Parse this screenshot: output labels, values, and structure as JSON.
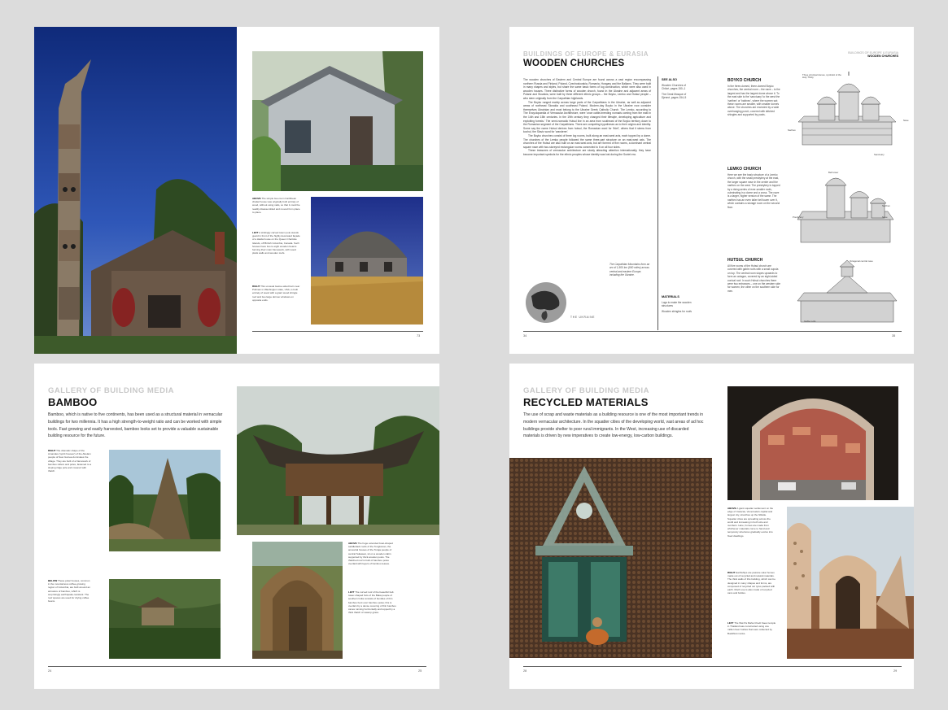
{
  "spread1": {
    "captions": [
      {
        "label": "ABOVE",
        "text": "The simple two-room Caribbean chattel house was originally built entirely of wood, without using nails, so that it could be readily disassembled and moved from place to place."
      },
      {
        "label": "LEFT",
        "text": "A strikingly carved totem pole stands guard in front of the highly decorated façade of a Haida house on the Queen Charlotte Islands, off British Columbia, Canada. Such houses have two to eight wooden beams forming their main framework, with wood plank walls and wooden roofs."
      },
      {
        "label": "RIGHT",
        "text": "This unusual twelve-sided barn near Pullman in Washington state, USA, is built entirely of wood with a giant wood shingle roof and two large dormer windows on opposite ends."
      }
    ],
    "page_right": "73"
  },
  "spread2": {
    "kicker": "BUILDINGS OF EUROPE & EURASIA",
    "title": "WOODEN CHURCHES",
    "running_head_1": "BUILDINGS OF EUROPE & EURASIA",
    "running_head_2": "WOODEN CHURCHES",
    "body": [
      "The wooden churches of Eastern and Central Europe are found across a vast region encompassing northern Russia and Finland, Poland, Czechoslovakia, Romania, Hungary and the Balkans. They were built in many shapes and styles, but share the same basic forms of log construction, which were also used in wooden houses. Three distinctive forms of wooden church, found in the Ukraine and adjacent areas of Poland and Slovakia, were built by three different ethnic groups – the Boyko, Lemko and Hutsul people – who stem originally from the Carpathian highlands.",
      "The Boyko ranged mainly across large parts of the Carpathians in the Ukraine, as well as adjacent areas of northeast Slovakia and southeast Poland. Modern-day Boyko in the Ukraine now consider themselves Ukrainian and most belong to the Ukraine Greek Catholic Church. The Lemko, according to The Encyclopaedia of Vernacular Architecture, were 'once cattle-breeding nomads coming from the east in the 14th and 15th centuries. In the 19th century they changed their lifestyle, developing agriculture and exploiting forests.' The semi-nomadic Hutsul live in an area from southeast of the Boyko territory down to the Romanian segment of the Carpathians. There are competing hypotheses as to their origins and identity. Some say the name Hutsul derives from hotsul, the Romanian word for 'thief', others that it stems from kochul, the Slavic word for 'wanderer'.",
      "The Boyko churches consist of three log rooms, built along an east-west axis, each topped by a dome. The churches of the Lemko people followed the same three-part structure on an east-west axis. The churches of the Hutsul are also built on an east-west axis, but are formed of five rooms, a dominant central square nave with two-storeyed rectangular rooms connected to it on all four sides.",
      "These treasures of vernacular architecture are slowly attracting attention internationally, they have become important symbols for the ethnic peoples whose identity was lost during the Soviet era."
    ],
    "see_also_label": "SEE ALSO",
    "see_also_items": [
      "Wooden Churches of Chiloé, pages 150–1",
      "The Great Mosque of Djenné, pages 154–5"
    ],
    "materials_label": "MATERIALS",
    "materials_items": [
      "Logs to make the wooden structures",
      "Wooden shingles for roofs"
    ],
    "map_caption": "The Carpathian Mountains form an arc of 1,500 km (900 miles) across central and eastern Europe, including the Ukraine.",
    "map_label": "THE UKRAINE",
    "sections": [
      {
        "heading": "BOYKO CHURCH",
        "text": "In the three-domed, three-domed Boyko churches, the central room – the nave – is the largest and has the largest dome above it. To the east side is the 'sanctuary' to the west the 'narthex' or 'babinec', where the women sat; these rooms are smaller, with smaller domes above. The churches are encircled by a wide overhanging porch, covered with stitched shingles and supported by posts."
      },
      {
        "heading": "LEMKO CHURCH",
        "text": "Here we see the basic structure of a Lemko church, with the small presbytery at the east, the larger square nave in the centre and the narthex on the west. The presbytery is topped by a rising series of ever-smaller roofs, culminating in a dome and a cross. The nave is a larger, higher version of the same. The narthex has an even taller bell tower over it, which contains a storage room on the second floor."
      },
      {
        "heading": "HUTSUL CHURCH",
        "text": "All five rooms of the Hutsul church are covered with gable roofs with a small cupola on top. The central room slopes upwards to form an octagon, covered by an eight-sided conical roof. In such Hutsul churches there were two entrances – one on the western side for women, the other on the southern side for men."
      }
    ],
    "diagram_labels": {
      "boyko_top": "Three principal domes, symbolic of the Holy Trinity",
      "boyko_narthex": "Narthex",
      "boyko_nave": "Nave",
      "boyko_sanctuary": "Sanctuary",
      "lemko_bell": "Bell tower",
      "lemko_narthex": "Narthex",
      "lemko_presbytery": "Presbytery",
      "lemko_nave": "Nave",
      "hutsul_octagon": "Octagonal central nave",
      "hutsul_gable": "Gable roofs"
    },
    "page_left": "34",
    "page_right": "35"
  },
  "spread3": {
    "kicker": "GALLERY OF BUILDING MEDIA",
    "title": "BAMBOO",
    "intro": "Bamboo, which is native to five continents, has been used as a structural material in vernacular buildings for two millennia. It has a high strength-to-weight ratio and can be worked with simple tools. Fast growing and easily harvested, bamboo looks set to provide a valuable sustainable building resource for the future.",
    "captions": [
      {
        "label": "RIGHT",
        "text": "The dramatic shape of the Amandes ('spirit houses') of the Abelam people of New Guinea dominates the village. They are built of a framework of bamboo rafters and poles, fastened to a sloping ridge pole and covered with thatch."
      },
      {
        "label": "BELOW",
        "text": "These polar houses, common in the mountainous coffee-growing region of Colombia, are built around an armature of bamboo, which is surprisingly earthquake-resistant. The roof spaces are used for drying coffee beans."
      },
      {
        "label": "ABOVE",
        "text": "The huge extended boat-shaped saddleback roofs of the Tongkonan, the ancestral houses of the Toraja people of central Sulawesi, sit on a wooden cabin supported by thick wooden posts. The thatched roof is built of bamboo poles overlaid with layers of bamboo leaves."
      },
      {
        "label": "LEFT",
        "text": "The curved roof of the beautiful bell-tower-shaped huts of the Baka people of southern India consists of bundles of thin bamboo bent over bamboo poles; this is overlain by a dense covering of thin bamboo canes running horizontally and topped by a thick thatch of swamp grass."
      }
    ],
    "page_left": "24",
    "page_right": "25"
  },
  "spread4": {
    "kicker": "GALLERY OF BUILDING MEDIA",
    "title": "RECYCLED MATERIALS",
    "intro": "The use of scrap and waste materials as a building resource is one of the most important trends in modern vernacular architecture. In the squatter cities of the developing world, vast areas of ad hoc buildings provide shelter to poor rural immigrants. In the West, increasing use of discarded materials is driven by new imperatives to create low-energy, low-carbon buildings.",
    "captions": [
      {
        "label": "ABOVE",
        "text": "A giant squatter settlement on the edge of Caracas, Venezuela's capital and largest city, stretches up the hillside. Squatter cities are spreading across the world and increasing in both size and numbers. Here, homes are made from whichever materials come to hand and temporary structures gradually evolve into fixed dwellings."
      },
      {
        "label": "RIGHT",
        "text": "Earthships are passive solar homes made out of recycled and natural materials. The thick walls of this building, which can be designed in many shapes and forms, are composed of recycled car tyres packed with earth. Much use is also made of recycled cans and bottles."
      },
      {
        "label": "LEFT",
        "text": "The Wat Pa Maha Chedi Kaew temple in Thailand was constructed using one million beer bottles that were collected by Buddhist monks."
      }
    ],
    "page_left": "28",
    "page_right": "29"
  }
}
